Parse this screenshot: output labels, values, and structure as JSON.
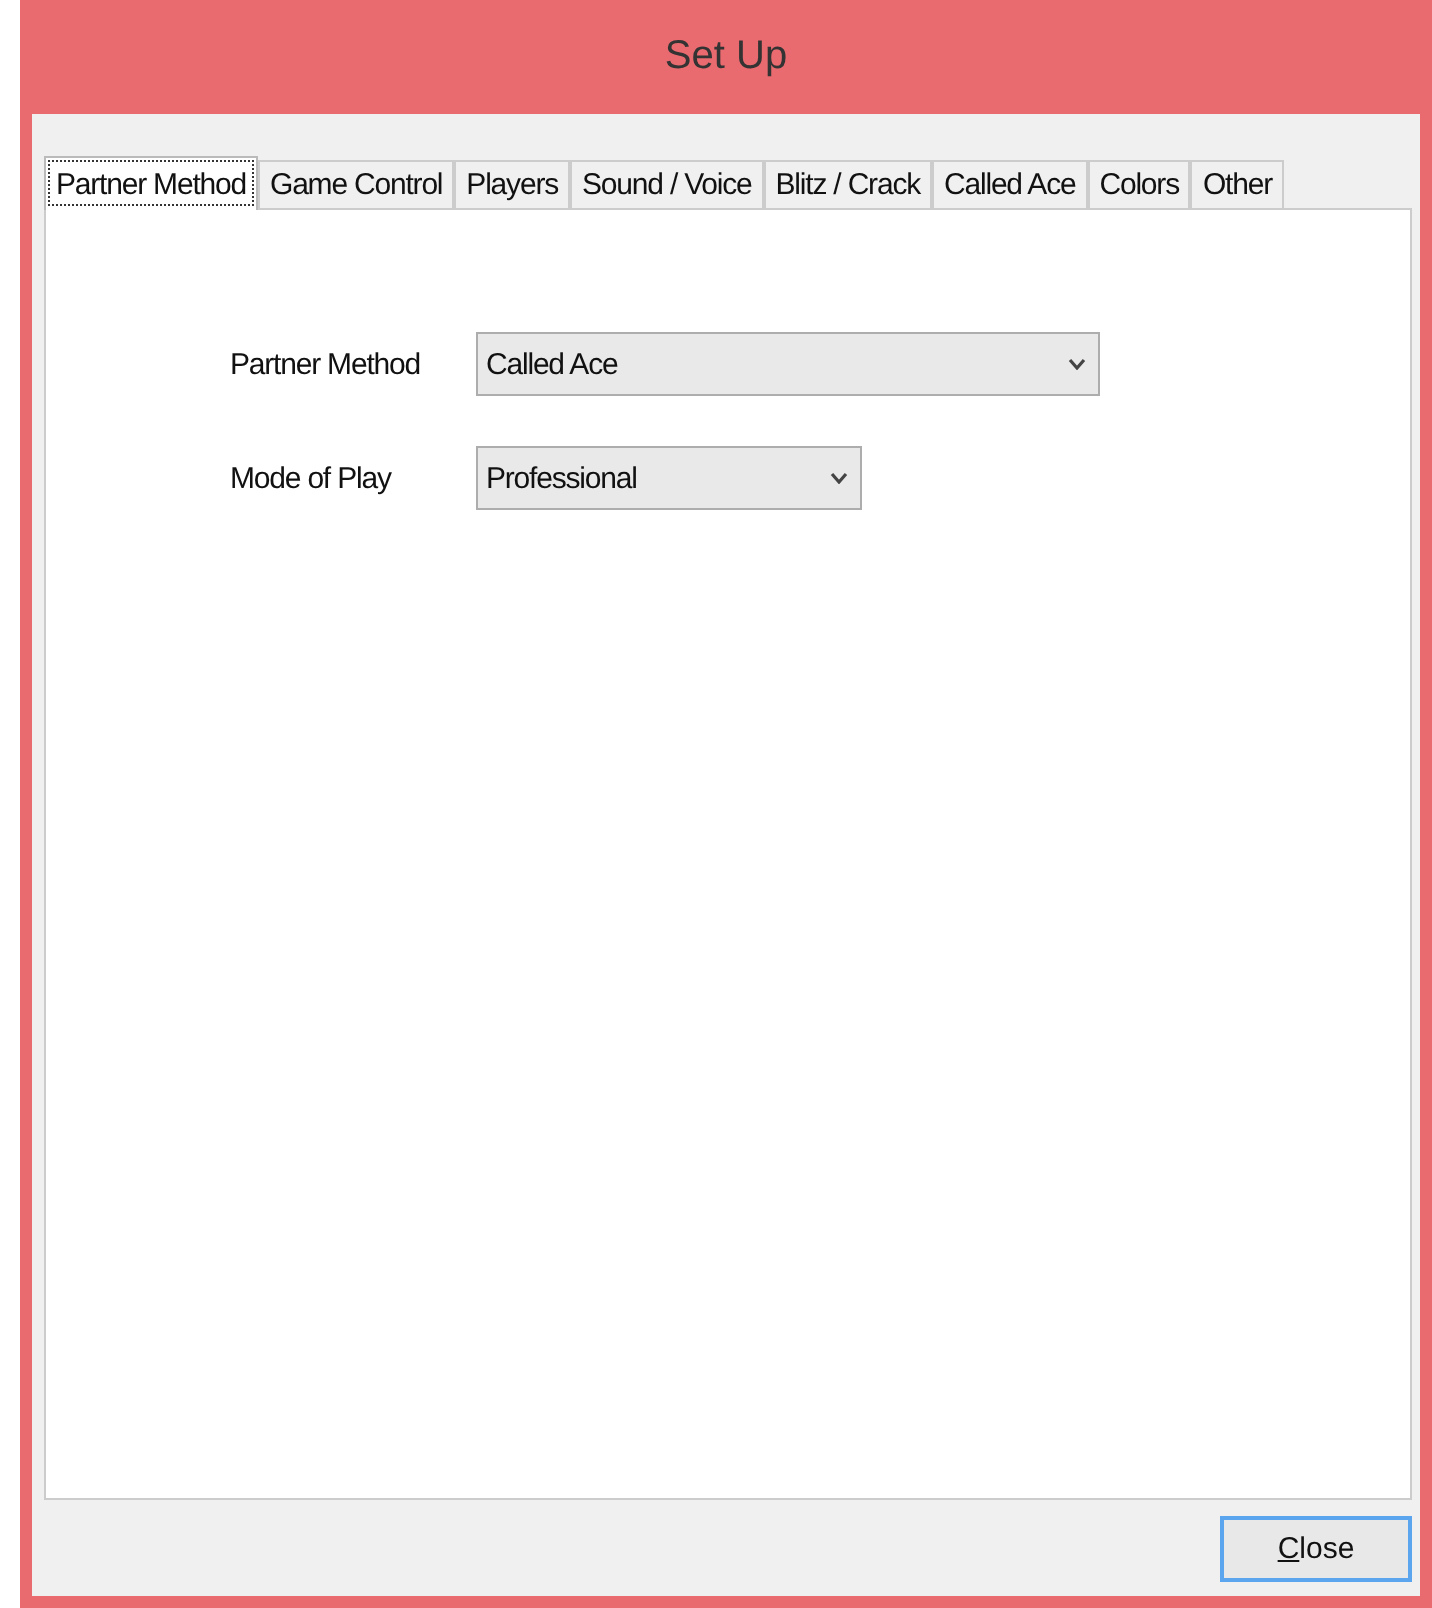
{
  "window": {
    "title": "Set Up"
  },
  "tabs": [
    {
      "label": "Partner Method",
      "selected": true
    },
    {
      "label": "Game Control",
      "selected": false
    },
    {
      "label": "Players",
      "selected": false
    },
    {
      "label": "Sound / Voice",
      "selected": false
    },
    {
      "label": "Blitz / Crack",
      "selected": false
    },
    {
      "label": "Called Ace",
      "selected": false
    },
    {
      "label": "Colors",
      "selected": false
    },
    {
      "label": "Other",
      "selected": false
    }
  ],
  "fields": [
    {
      "label": "Partner Method",
      "value": "Called Ace",
      "kind": "wide"
    },
    {
      "label": "Mode of Play",
      "value": "Professional",
      "kind": "narrow"
    }
  ],
  "buttons": [
    {
      "label": "Close",
      "focused": true
    }
  ]
}
